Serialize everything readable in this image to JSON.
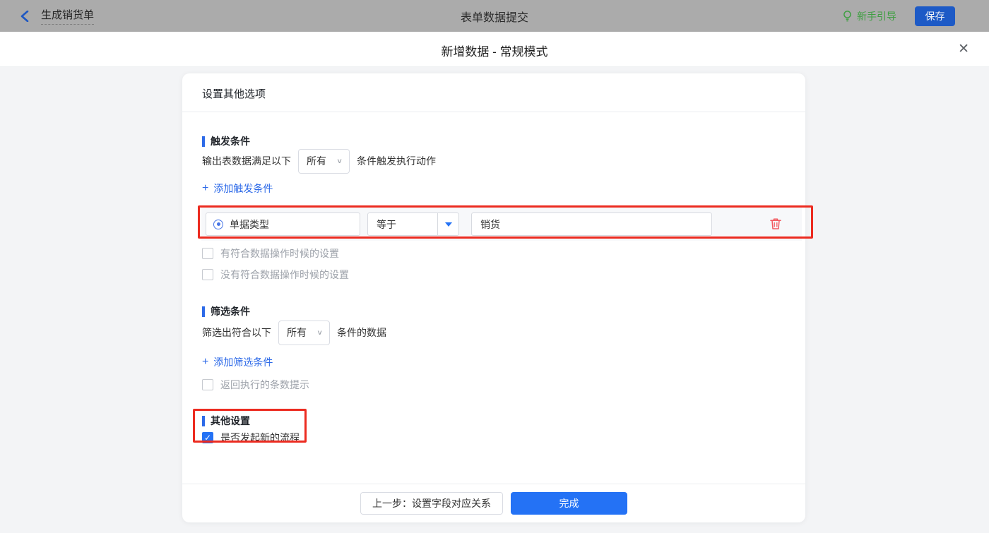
{
  "topbar": {
    "back_title": "生成销货单",
    "center_title": "表单数据提交",
    "guide_label": "新手引导",
    "save_label": "保存"
  },
  "dialog": {
    "title": "新增数据 - 常规模式"
  },
  "card": {
    "header": "设置其他选项",
    "trigger": {
      "title": "触发条件",
      "prefix": "输出表数据满足以下",
      "select_value": "所有",
      "suffix": "条件触发执行动作",
      "add_label": "添加触发条件",
      "condition": {
        "field": "单据类型",
        "operator": "等于",
        "value": "销货"
      },
      "checkboxes": [
        "有符合数据操作时候的设置",
        "没有符合数据操作时候的设置"
      ]
    },
    "filter": {
      "title": "筛选条件",
      "prefix": "筛选出符合以下",
      "select_value": "所有",
      "suffix": "条件的数据",
      "add_label": "添加筛选条件",
      "checkbox": "返回执行的条数提示"
    },
    "other": {
      "title": "其他设置",
      "checkbox": "是否发起新的流程",
      "checked": true
    },
    "footer": {
      "prev_label": "上一步：设置字段对应关系",
      "done_label": "完成"
    }
  },
  "icons": {
    "plus": "+",
    "chevron_down": "∨",
    "close": "✕",
    "check": "✓"
  },
  "colors": {
    "accent_blue": "#2472f5",
    "link_blue": "#2d6ae8",
    "annotation_red": "#ec2b20",
    "guide_green": "#3f9f42",
    "trash_red": "#f2595f",
    "topbar_gray": "#ababab"
  }
}
